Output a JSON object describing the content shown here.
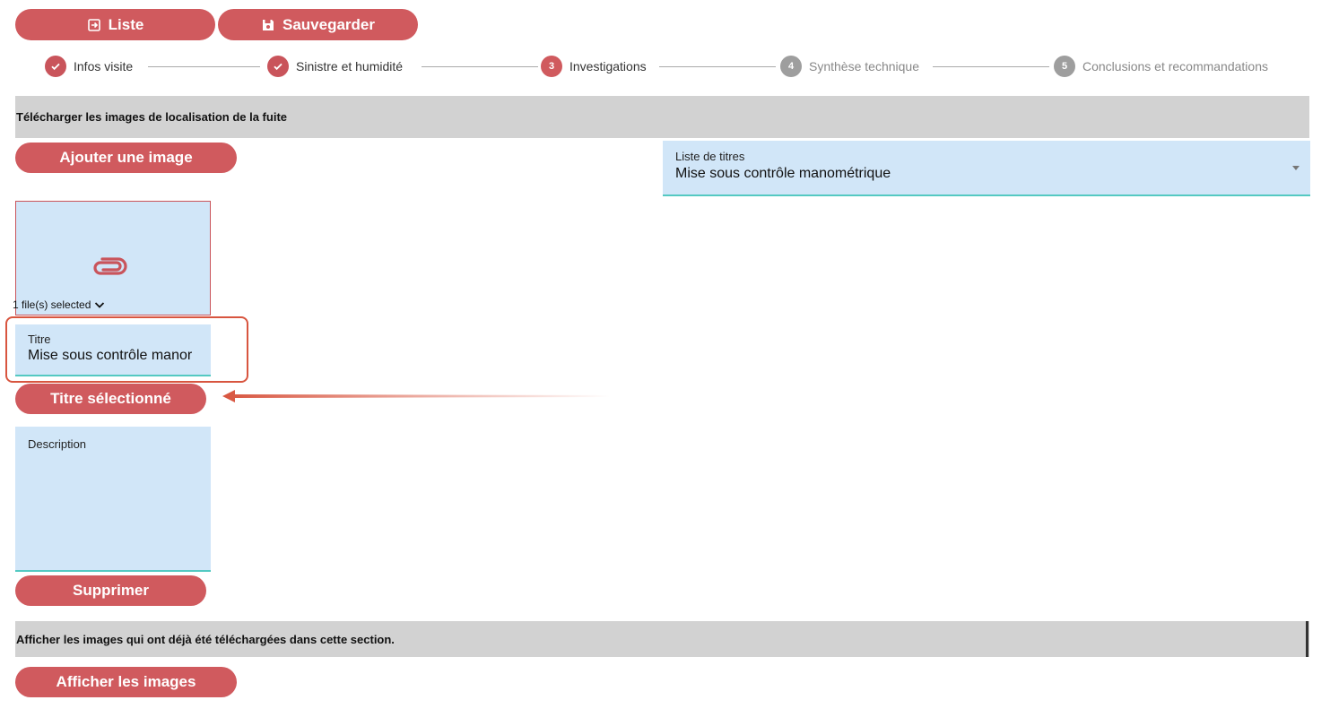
{
  "toolbar": {
    "liste_label": "Liste",
    "save_label": "Sauvegarder"
  },
  "stepper": {
    "steps": [
      {
        "number": "1",
        "label": "Infos visite",
        "state": "done"
      },
      {
        "number": "2",
        "label": "Sinistre et humidité",
        "state": "done"
      },
      {
        "number": "3",
        "label": "Investigations",
        "state": "active"
      },
      {
        "number": "4",
        "label": "Synthèse technique",
        "state": "todo"
      },
      {
        "number": "5",
        "label": "Conclusions et recommandations",
        "state": "todo"
      }
    ]
  },
  "upload_section": {
    "header": "Télécharger les images de localisation de la fuite",
    "add_image_label": "Ajouter une image",
    "file_selected_text": "1 file(s) selected",
    "title_list": {
      "label": "Liste de titres",
      "value": "Mise sous contrôle manométrique"
    },
    "titre_field": {
      "label": "Titre",
      "value": "Mise sous contrôle manor"
    },
    "selected_title_button": "Titre sélectionné",
    "description_label": "Description",
    "delete_label": "Supprimer"
  },
  "view_section": {
    "header": "Afficher les images qui ont déjà été téléchargées dans cette section.",
    "show_images_label": "Afficher les images"
  },
  "colors": {
    "button": "#d05a5e",
    "field_bg": "#d1e6f8",
    "field_underline": "#54c9c2",
    "section_bar": "#d2d2d2",
    "highlight": "#d8553f"
  }
}
